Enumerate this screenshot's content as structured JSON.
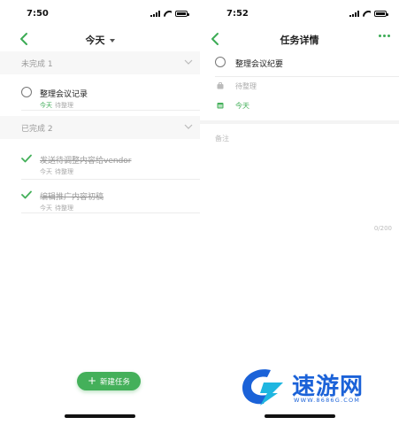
{
  "left": {
    "status_time": "7:50",
    "nav_title": "今天",
    "incomplete_header": "未完成 1",
    "completed_header": "已完成 2",
    "incomplete_tasks": [
      {
        "title": "整理会议记录",
        "date": "今天",
        "list": "待整理"
      }
    ],
    "completed_tasks": [
      {
        "title": "发送待调整内容给vendor",
        "date": "今天",
        "list": "待整理"
      },
      {
        "title": "编辑推广内容初稿",
        "date": "今天",
        "list": "待整理"
      }
    ],
    "new_task_label": "新建任务"
  },
  "right": {
    "status_time": "7:52",
    "nav_title": "任务详情",
    "task_title": "整理会议纪要",
    "list_name": "待整理",
    "due_date": "今天",
    "notes_placeholder": "备注",
    "char_count": "0/200"
  },
  "watermark": {
    "text": "速游网",
    "url": "WWW.8686G.COM"
  },
  "icons": {
    "back": "chevron-left-icon",
    "more": "more-dots-icon",
    "caret": "caret-down-icon",
    "check": "checkmark-icon",
    "folder": "folder-icon",
    "calendar": "calendar-icon"
  },
  "colors": {
    "accent_green": "#44b05a",
    "watermark_blue": "#1b62d8",
    "watermark_cyan": "#1fb6e0"
  }
}
